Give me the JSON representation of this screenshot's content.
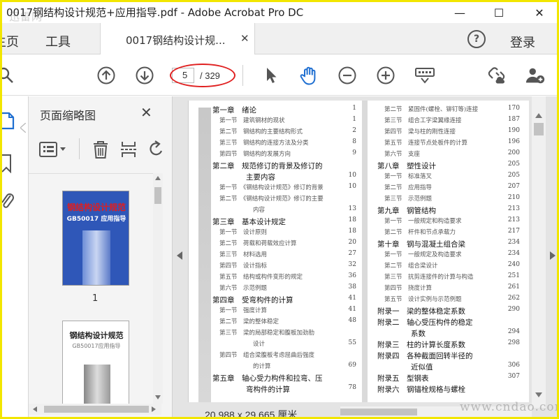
{
  "window": {
    "title": "0017钢结构设计规范+应用指导.pdf - Adobe Acrobat Pro DC",
    "watermark_logo": "迅雷网",
    "minimize": "—",
    "maximize": "☐",
    "close": "✕"
  },
  "tabs": {
    "home": "主页",
    "tools": "工具",
    "document": "0017钢结构设计规...",
    "document_close": "✕",
    "help": "?",
    "login": "登录"
  },
  "toolbar": {
    "current_page": "5",
    "total_pages": "/ 329"
  },
  "thumbnail_panel": {
    "title": "页面缩略图",
    "close": "✕",
    "page1_label": "1",
    "cover_title": "钢结构设计规范",
    "cover_subtitle": "GB50017 应用指导",
    "page2_title": "钢结构设计规范",
    "page2_subtitle": "GB50017应用指导"
  },
  "document": {
    "page_size": "20.988 x 29.665 厘米",
    "toc_left": [
      {
        "text": "第一章　绪论",
        "page": "1",
        "level": 1
      },
      {
        "text": "第一节　建筑钢材的现状",
        "page": "1",
        "level": 2
      },
      {
        "text": "第二节　钢结构的主要结构形式",
        "page": "2",
        "level": 2
      },
      {
        "text": "第三节　钢结构的连接方法及分类",
        "page": "8",
        "level": 2
      },
      {
        "text": "第四节　钢结构的发展方向",
        "page": "9",
        "level": 2
      },
      {
        "text": "第二章　规范修订的背景及修订的",
        "page": "",
        "level": 1
      },
      {
        "text": "主要内容",
        "page": "10",
        "level": 3
      },
      {
        "text": "第一节　《钢结构设计规范》修订的背景",
        "page": "10",
        "level": 2
      },
      {
        "text": "第二节　《钢结构设计规范》修订的主要",
        "page": "",
        "level": 2
      },
      {
        "text": "内容",
        "page": "13",
        "level": 4
      },
      {
        "text": "第三章　基本设计规定",
        "page": "18",
        "level": 1
      },
      {
        "text": "第一节　设计原则",
        "page": "18",
        "level": 2
      },
      {
        "text": "第二节　荷载和荷载效应计算",
        "page": "20",
        "level": 2
      },
      {
        "text": "第三节　材料选用",
        "page": "27",
        "level": 2
      },
      {
        "text": "第四节　设计指标",
        "page": "32",
        "level": 2
      },
      {
        "text": "第五节　结构或构件变形的规定",
        "page": "36",
        "level": 2
      },
      {
        "text": "第六节　示范例题",
        "page": "38",
        "level": 2
      },
      {
        "text": "第四章　受弯构件的计算",
        "page": "41",
        "level": 1
      },
      {
        "text": "第一节　强度计算",
        "page": "41",
        "level": 2
      },
      {
        "text": "第二节　梁的整体稳定",
        "page": "48",
        "level": 2
      },
      {
        "text": "第三节　梁的局部稳定和腹板加劲肋",
        "page": "",
        "level": 2
      },
      {
        "text": "设计",
        "page": "55",
        "level": 4
      },
      {
        "text": "第四节　组合梁腹板考虑屈曲后强度",
        "page": "",
        "level": 2
      },
      {
        "text": "的计算",
        "page": "69",
        "level": 4
      },
      {
        "text": "第五章　轴心受力构件和拉弯、压",
        "page": "",
        "level": 1
      },
      {
        "text": "弯构件的计算",
        "page": "78",
        "level": 3
      }
    ],
    "toc_right": [
      {
        "text": "第二节　紧固件(螺栓、铆钉等)连接",
        "page": "170",
        "level": 2
      },
      {
        "text": "第三节　组合工字梁翼缘连接",
        "page": "187",
        "level": 2
      },
      {
        "text": "第四节　梁与柱的刚性连接",
        "page": "190",
        "level": 2
      },
      {
        "text": "第五节　连接节点处板件的计算",
        "page": "196",
        "level": 2
      },
      {
        "text": "第六节　支座",
        "page": "200",
        "level": 2
      },
      {
        "text": "第八章　塑性设计",
        "page": "205",
        "level": 1
      },
      {
        "text": "第一节　标准落叉",
        "page": "205",
        "level": 2
      },
      {
        "text": "第二节　应用指导",
        "page": "207",
        "level": 2
      },
      {
        "text": "第三节　示范例题",
        "page": "210",
        "level": 2
      },
      {
        "text": "第九章　钢管结构",
        "page": "213",
        "level": 1
      },
      {
        "text": "第一节　一般规定和构造要求",
        "page": "213",
        "level": 2
      },
      {
        "text": "第二节　杆件和节点承载力",
        "page": "217",
        "level": 2
      },
      {
        "text": "第十章　钢与混凝土组合梁",
        "page": "234",
        "level": 1
      },
      {
        "text": "第一节　一般规定及构造要求",
        "page": "234",
        "level": 2
      },
      {
        "text": "第二节　组合梁设计",
        "page": "240",
        "level": 2
      },
      {
        "text": "第三节　抗剪连接件的计算与构造",
        "page": "251",
        "level": 2
      },
      {
        "text": "第四节　挠度计算",
        "page": "261",
        "level": 2
      },
      {
        "text": "第五节　设计实例与示范例题",
        "page": "262",
        "level": 2
      },
      {
        "text": "附录一　梁的整体稳定系数",
        "page": "290",
        "level": 1
      },
      {
        "text": "附录二　轴心受压构件的稳定",
        "page": "",
        "level": 1
      },
      {
        "text": "系数",
        "page": "294",
        "level": 3
      },
      {
        "text": "附录三　柱的计算长度系数",
        "page": "298",
        "level": 1
      },
      {
        "text": "附录四　各种截面回转半径的",
        "page": "",
        "level": 1
      },
      {
        "text": "近似值",
        "page": "306",
        "level": 3
      },
      {
        "text": "附录五　型钢表",
        "page": "307",
        "level": 1
      },
      {
        "text": "附录六　钢锚栓规格与螺栓",
        "page": "",
        "level": 1
      }
    ],
    "watermark": "www.cndao.com"
  },
  "colors": {
    "frame_border": "#f2e600",
    "pager_highlight": "#e02020",
    "hand_tool_active": "#1f6fd1"
  }
}
